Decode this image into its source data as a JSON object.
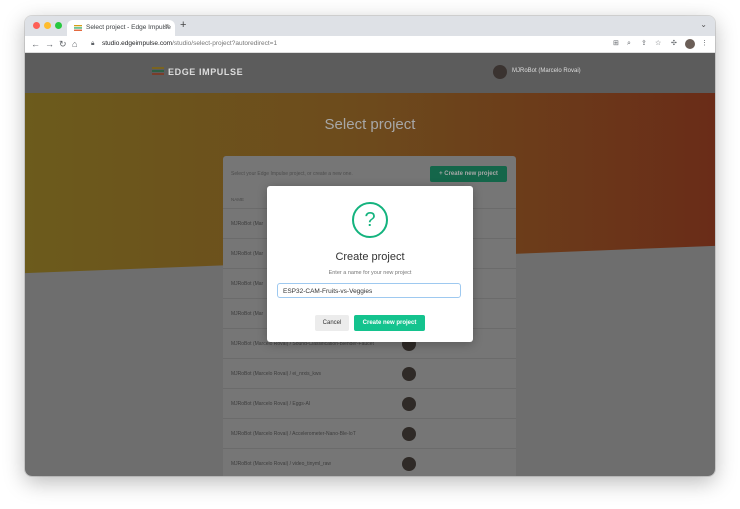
{
  "browser": {
    "tab_title": "Select project - Edge Impulse",
    "tab_close": "×",
    "new_tab": "+",
    "url_host": "studio.edgeimpulse.com",
    "url_path": "/studio/select-project?autoredirect=1",
    "traffic_light_colors": [
      "#fe5f57",
      "#febc2e",
      "#28c840"
    ]
  },
  "header": {
    "brand": "EDGE IMPULSE",
    "user": "MJRoBot (Marcelo Rovai)",
    "logo_colors": [
      "#d4a017",
      "#2fae6a",
      "#e05a2b"
    ]
  },
  "page": {
    "title": "Select project",
    "card_intro": "Select your Edge Impulse project, or create a new one.",
    "new_project_button": "+ Create new project",
    "column_name": "NAME",
    "rows": [
      {
        "name": "MJRoBot (Marcelo Rovai) / ..."
      },
      {
        "name": "MJRoBot (Marcelo Rovai) / ..."
      },
      {
        "name": "MJRoBot (Marcelo Rovai) / ..."
      },
      {
        "name": "MJRoBot (Marcelo Rovai) / ..."
      },
      {
        "name": "MJRoBot (Marcelo Rovai) / Sound-Classification-Blender-Faucet"
      },
      {
        "name": "MJRoBot (Marcelo Rovai) / ei_nrxis_kws"
      },
      {
        "name": "MJRoBot (Marcelo Rovai) / Eggs-AI"
      },
      {
        "name": "MJRoBot (Marcelo Rovai) / Accelerometer-Nano-Ble-IoT"
      },
      {
        "name": "MJRoBot (Marcelo Rovai) / video_tinyml_raw"
      }
    ],
    "truncated_row_label": "MJRoBot (Mar"
  },
  "modal": {
    "icon": "question-mark-icon",
    "icon_glyph": "?",
    "title": "Create project",
    "subtitle": "Enter a name for your new project",
    "input_value": "ESP32-CAM-Fruits-vs-Veggies",
    "cancel_label": "Cancel",
    "create_label": "Create new project",
    "accent_color": "#14c38e"
  }
}
